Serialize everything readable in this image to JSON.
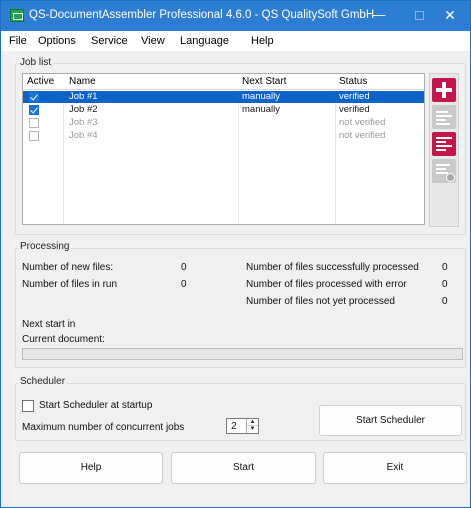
{
  "window": {
    "title": "QS-DocumentAssembler Professional 4.6.0 - QS QualitySoft GmbH",
    "minimize_glyph": "—",
    "close_glyph": "✕",
    "accent": "#2d7dd2"
  },
  "menu": [
    "File",
    "Options",
    "Service",
    "View",
    "Language",
    "Help"
  ],
  "job_list": {
    "title": "Job list",
    "columns": [
      "Active",
      "Name",
      "Next Start",
      "Status"
    ],
    "rows": [
      {
        "active": true,
        "name": "Job #1",
        "next_start": "manually",
        "status": "verified",
        "selected": true,
        "enabled": true
      },
      {
        "active": true,
        "name": "Job #2",
        "next_start": "manually",
        "status": "verified",
        "selected": false,
        "enabled": true
      },
      {
        "active": false,
        "name": "Job #3",
        "next_start": "",
        "status": "not verified",
        "selected": false,
        "enabled": false
      },
      {
        "active": false,
        "name": "Job #4",
        "next_start": "",
        "status": "not verified",
        "selected": false,
        "enabled": false
      }
    ],
    "side_buttons": [
      "add-job-icon",
      "edit-job-icon",
      "job-details-icon",
      "delete-job-icon"
    ]
  },
  "processing": {
    "title": "Processing",
    "new_files_label": "Number of new files:",
    "new_files_value": "0",
    "files_in_run_label": "Number of files in run",
    "files_in_run_value": "0",
    "success_label": "Number of files successfully processed",
    "success_value": "0",
    "error_label": "Number of files processed with error",
    "error_value": "0",
    "not_yet_label": "Number of files not yet processed",
    "not_yet_value": "0",
    "next_start_label": "Next start in",
    "current_doc_label": "Current document:",
    "progress": 0
  },
  "scheduler": {
    "title": "Scheduler",
    "startup_label": "Start Scheduler at startup",
    "startup_checked": false,
    "max_jobs_label": "Maximum number of concurrent jobs",
    "max_jobs_value": "2",
    "start_scheduler_label": "Start Scheduler"
  },
  "footer": {
    "help_label": "Help",
    "start_label": "Start",
    "exit_label": "Exit"
  }
}
